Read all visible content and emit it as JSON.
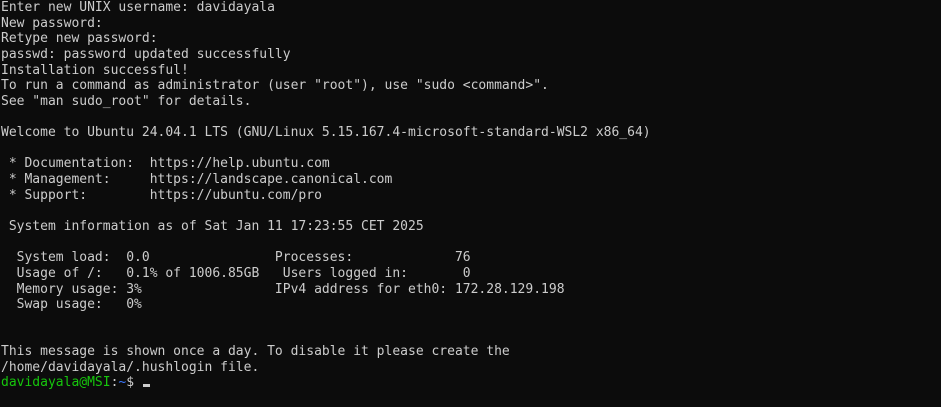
{
  "terminal": {
    "lines": [
      "Enter new UNIX username: davidayala",
      "New password:",
      "Retype new password:",
      "passwd: password updated successfully",
      "Installation successful!",
      "To run a command as administrator (user \"root\"), use \"sudo <command>\".",
      "See \"man sudo_root\" for details.",
      "",
      "Welcome to Ubuntu 24.04.1 LTS (GNU/Linux 5.15.167.4-microsoft-standard-WSL2 x86_64)",
      "",
      " * Documentation:  https://help.ubuntu.com",
      " * Management:     https://landscape.canonical.com",
      " * Support:        https://ubuntu.com/pro",
      "",
      " System information as of Sat Jan 11 17:23:55 CET 2025",
      "",
      "  System load:  0.0                Processes:             76",
      "  Usage of /:   0.1% of 1006.85GB   Users logged in:       0",
      "  Memory usage: 3%                 IPv4 address for eth0: 172.28.129.198",
      "  Swap usage:   0%",
      "",
      "",
      "This message is shown once a day. To disable it please create the",
      "/home/davidayala/.hushlogin file."
    ],
    "prompt": {
      "user_host": "davidayala@MSI",
      "separator": ":",
      "path": "~",
      "symbol": "$ "
    },
    "colors": {
      "background": "#0c0c0c",
      "foreground": "#cccccc",
      "user_host": "#16c60c",
      "path": "#3b78ff"
    }
  }
}
